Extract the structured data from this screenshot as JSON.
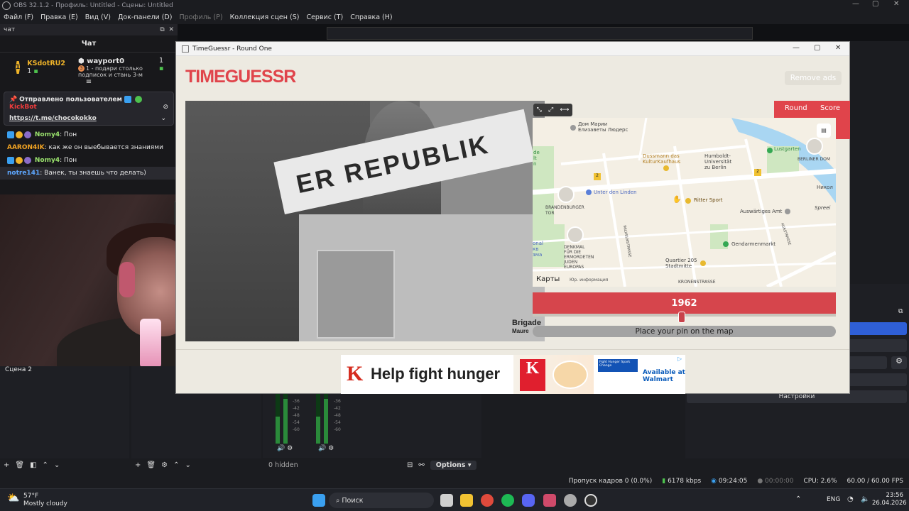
{
  "obs": {
    "title": "OBS 32.1.2 - Профиль: Untitled - Сцены: Untitled",
    "menu": [
      "Файл (F)",
      "Правка (E)",
      "Вид (V)",
      "Док-панели (D)",
      "Профиль (P)",
      "Коллекция сцен (S)",
      "Сервис (T)",
      "Справка (H)"
    ],
    "chat_dock_label": "чат",
    "scene_label": "Сцена 2",
    "mixer_hidden": "0 hidden",
    "options_label": "Options",
    "settings_label": "Настройки",
    "meter_ticks": [
      "-36",
      "-42",
      "-48",
      "-54",
      "-60"
    ],
    "status": {
      "dropped": "Пропуск кадров 0 (0.0%)",
      "bitrate": "6178 kbps",
      "stream_time": "09:24:05",
      "rec_time": "00:00:00",
      "cpu": "CPU: 2.6%",
      "fps": "60.00 / 60.00 FPS"
    }
  },
  "chat": {
    "header": "Чат",
    "leaders": [
      {
        "badge": "1",
        "name": "KSdotRU2",
        "count": "1"
      },
      {
        "name": "wayport0",
        "count": "1",
        "note": "1 - подари столько подписок и стань 3-м",
        "badge": "3"
      }
    ],
    "pinned_by": "Отправлено пользователем",
    "pinned_user": "KickBot",
    "pinned_link": "https://t.me/chocokokko",
    "messages": [
      {
        "user": "Nomy4",
        "text": "Пон",
        "color": "#9be36e"
      },
      {
        "user": "AARON4IK",
        "text": "как же он выебывается знаниями",
        "color": "#f5a623"
      },
      {
        "user": "Nomy4",
        "text": "Пон",
        "color": "#9be36e"
      },
      {
        "user": "notre141",
        "text": "Ванек, ты знаешь что делать)",
        "color": "#5ea7ff"
      }
    ]
  },
  "timeguessr": {
    "window_title": "TimeGuessr - Round One",
    "logo": "TIMEGUESSR",
    "remove_ads": "Remove ads",
    "round_label": "Round",
    "score_label": "Score",
    "photo_sign": "ER REPUBLIK",
    "photo_corner": [
      "Brigade",
      "Maure"
    ],
    "year": "1962",
    "slider_fraction": 0.5,
    "pin_prompt": "Place your pin on the map",
    "map": {
      "attribution": "Карты",
      "legal": "Юр. информация",
      "labels": {
        "dom_marii": "Дом Марии\nЕлизаветы Людерс",
        "dussmann": "Dussmann das\nKulturKaufhaus",
        "humboldt": "Humboldt-\nUniversität\nzu Berlin",
        "lustgarten": "Lustgarten",
        "berliner_dom": "BERLINER DOM",
        "unter_den_linden": "Unter den Linden",
        "brandenburger": "BRANDENBURGER\nTOR",
        "ritter": "Ritter Sport",
        "auswaertiges": "Auswärtiges Amt",
        "spree": "Spreei",
        "nikol": "Никол",
        "denkmal": "DENKMAL\nFÜR DIE\nERMORDETEN\nJUDEN\nEUROPAS",
        "gendarmen": "Gendarmenmarkt",
        "quartier": "Quartier 205\nStadtmitte",
        "wilhelm": "WILHELMSTRASSE",
        "kronen": "KRONENSTRASSE",
        "kurstrasse": "KURSTRASSE",
        "left_edge": "onal\nкв\nзма",
        "route": "2",
        "route2": "2",
        "left_de": "de\nlt\nn"
      }
    },
    "ad": {
      "brand": "K",
      "headline": "Help fight hunger",
      "box_letter": "K",
      "blue": "Fight Hunger Spark Change",
      "cta": "Available at\nWalmart"
    }
  },
  "taskbar": {
    "weather_temp": "57°F",
    "weather_desc": "Mostly cloudy",
    "search": "Поиск",
    "lang": "ENG",
    "time": "23:56",
    "date": "26.04.2026"
  }
}
